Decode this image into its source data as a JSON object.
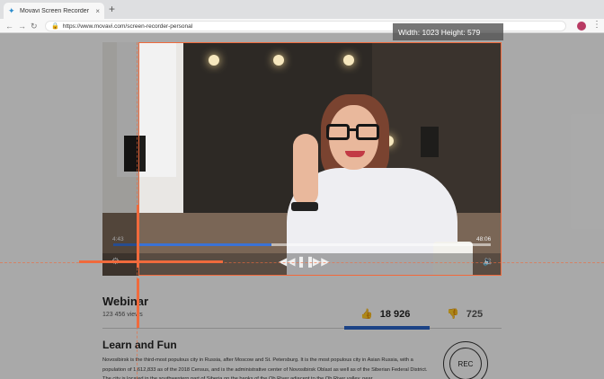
{
  "browser": {
    "tab_title": "Movavi Screen Recorder",
    "tab_close": "×",
    "new_tab": "+",
    "back": "←",
    "forward": "→",
    "reload": "↻",
    "url": "https://www.movavi.com/screen-recorder-personal",
    "menu": "⋮"
  },
  "video": {
    "time_start": "4:43",
    "time_end": "48:06",
    "progress_fraction": 0.42,
    "settings_icon": "⚙",
    "rewind": "◀◀",
    "pause": "❚❚",
    "forward": "▶▶",
    "volume_icon": "🔉"
  },
  "capture": {
    "size_label": "Width: 1023 Height: 579",
    "accent": "#f06a3c"
  },
  "content": {
    "title": "Webinar",
    "views": "123 456 views",
    "likes": "18 926",
    "dislikes": "725",
    "like_icon": "👍",
    "dislike_icon": "👎",
    "subtitle": "Learn and Fun",
    "paragraph": "Novosibirsk is the third-most populous city in Russia, after Moscow and St. Petersburg. It is the most populous city in Asian Russia, with a population of 1,612,833 as of the 2018 Census, and is the administrative center of Novosibirsk Oblast as well as of the Siberian Federal District. The city is located in the southwestern part of Siberia on the banks of the Ob River adjacent to the Ob River valley, near",
    "rec_label": "REC"
  }
}
